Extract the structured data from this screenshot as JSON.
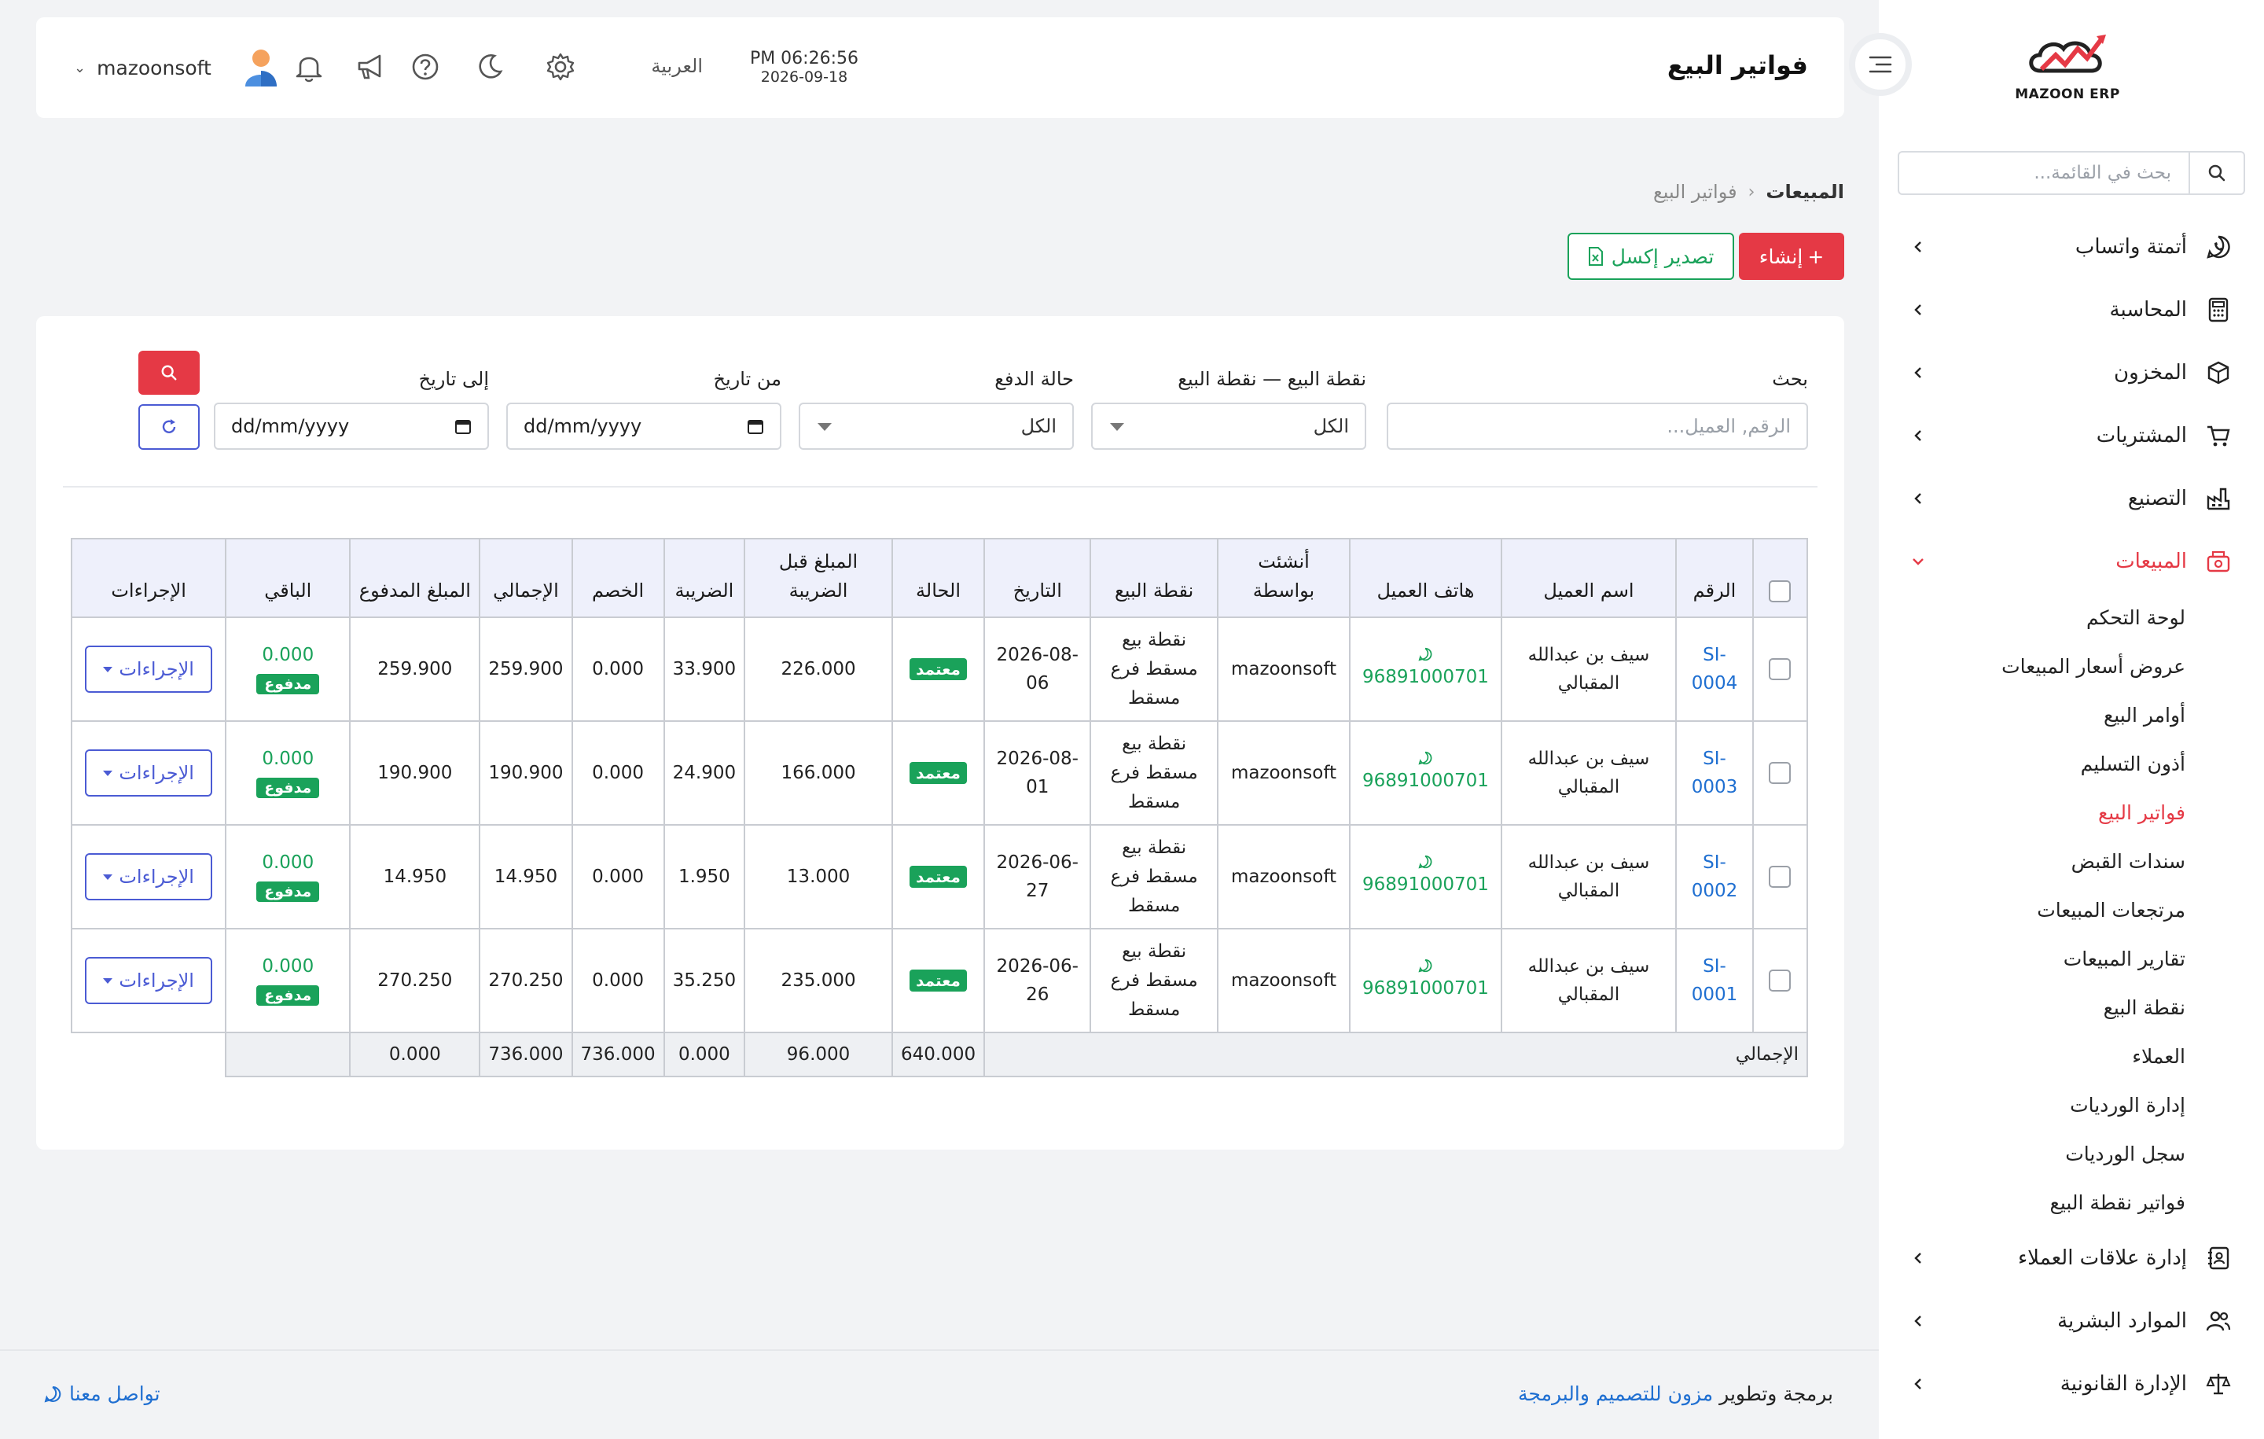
{
  "sidebar": {
    "logo_text": "MAZOON ERP",
    "search_placeholder": "بحث في القائمة...",
    "menu": [
      {
        "label": "أتمتة واتساب",
        "icon": "whatsapp-icon"
      },
      {
        "label": "المحاسبة",
        "icon": "calculator-icon"
      },
      {
        "label": "المخزون",
        "icon": "box-icon"
      },
      {
        "label": "المشتريات",
        "icon": "cart-icon"
      },
      {
        "label": "التصنيع",
        "icon": "factory-icon"
      },
      {
        "label": "المبيعات",
        "icon": "register-icon",
        "active": true
      }
    ],
    "sales_submenu": [
      "لوحة التحكم",
      "عروض أسعار المبيعات",
      "أوامر البيع",
      "أذون التسليم",
      "فواتير البيع",
      "سندات القبض",
      "مرتجعات المبيعات",
      "تقارير المبيعات",
      "نقطة البيع",
      "العملاء",
      "إدارة الورديات",
      "سجل الورديات",
      "فواتير نقطة البيع"
    ],
    "menu_bottom": [
      {
        "label": "إدارة علاقات العملاء",
        "icon": "crm-icon"
      },
      {
        "label": "الموارد البشرية",
        "icon": "users-icon"
      },
      {
        "label": "الإدارة القانونية",
        "icon": "scales-icon"
      }
    ]
  },
  "header": {
    "title": "فواتير البيع",
    "time": "PM 06:26:56",
    "date": "2026-09-18",
    "language": "العربية",
    "username": "mazoonsoft"
  },
  "breadcrumb": {
    "parent": "المبيعات",
    "current": "فواتير البيع"
  },
  "actions": {
    "create_label": "إنشاء",
    "export_label": "تصدير إكسل"
  },
  "filters": {
    "search_label": "بحث",
    "search_placeholder": "الرقم, العميل...",
    "pos_label": "نقطة البيع — نقطة البيع",
    "pos_value": "الكل",
    "payment_label": "حالة الدفع",
    "payment_value": "الكل",
    "from_label": "من تاريخ",
    "to_label": "إلى تاريخ",
    "date_placeholder": "dd/mm/yyyy"
  },
  "table": {
    "headers": {
      "number": "الرقم",
      "customer": "اسم العميل",
      "phone": "هاتف العميل",
      "created_by": "أنشئت بواسطة",
      "pos": "نقطة البيع",
      "date": "التاريخ",
      "status": "الحالة",
      "pre_tax": "المبلغ قبل الضريبة",
      "tax": "الضريبة",
      "discount": "الخصم",
      "total": "الإجمالي",
      "paid": "المبلغ المدفوع",
      "remaining": "الباقي",
      "actions": "الإجراءات"
    },
    "rows": [
      {
        "number": "SI-0004",
        "customer": "سيف بن عبدالله المقبالي",
        "phone": "96891000701",
        "created_by": "mazoonsoft",
        "pos": "نقطة بيع مسقط فرع مسقط",
        "date": "2026-08-06",
        "status": "معتمد",
        "pre_tax": "226.000",
        "tax": "33.900",
        "discount": "0.000",
        "total": "259.900",
        "paid": "259.900",
        "remaining": "0.000",
        "payment_badge": "مدفوع",
        "action_label": "الإجراءات"
      },
      {
        "number": "SI-0003",
        "customer": "سيف بن عبدالله المقبالي",
        "phone": "96891000701",
        "created_by": "mazoonsoft",
        "pos": "نقطة بيع مسقط فرع مسقط",
        "date": "2026-08-01",
        "status": "معتمد",
        "pre_tax": "166.000",
        "tax": "24.900",
        "discount": "0.000",
        "total": "190.900",
        "paid": "190.900",
        "remaining": "0.000",
        "payment_badge": "مدفوع",
        "action_label": "الإجراءات"
      },
      {
        "number": "SI-0002",
        "customer": "سيف بن عبدالله المقبالي",
        "phone": "96891000701",
        "created_by": "mazoonsoft",
        "pos": "نقطة بيع مسقط فرع مسقط",
        "date": "2026-06-27",
        "status": "معتمد",
        "pre_tax": "13.000",
        "tax": "1.950",
        "discount": "0.000",
        "total": "14.950",
        "paid": "14.950",
        "remaining": "0.000",
        "payment_badge": "مدفوع",
        "action_label": "الإجراءات"
      },
      {
        "number": "SI-0001",
        "customer": "سيف بن عبدالله المقبالي",
        "phone": "96891000701",
        "created_by": "mazoonsoft",
        "pos": "نقطة بيع مسقط فرع مسقط",
        "date": "2026-06-26",
        "status": "معتمد",
        "pre_tax": "235.000",
        "tax": "35.250",
        "discount": "0.000",
        "total": "270.250",
        "paid": "270.250",
        "remaining": "0.000",
        "payment_badge": "مدفوع",
        "action_label": "الإجراءات"
      }
    ],
    "totals": {
      "label": "الإجمالي",
      "pre_tax": "640.000",
      "tax": "96.000",
      "discount": "0.000",
      "total": "736.000",
      "paid": "736.000",
      "remaining": "0.000"
    }
  },
  "footer": {
    "credit_prefix": "برمجة وتطوير",
    "credit_link": "مزون للتصميم والبرمجة",
    "contact": "تواصل معنا"
  },
  "colors": {
    "accent": "#e53945",
    "success": "#1aa25a",
    "link": "#1f6fd1",
    "outline": "#4b5bd4"
  }
}
